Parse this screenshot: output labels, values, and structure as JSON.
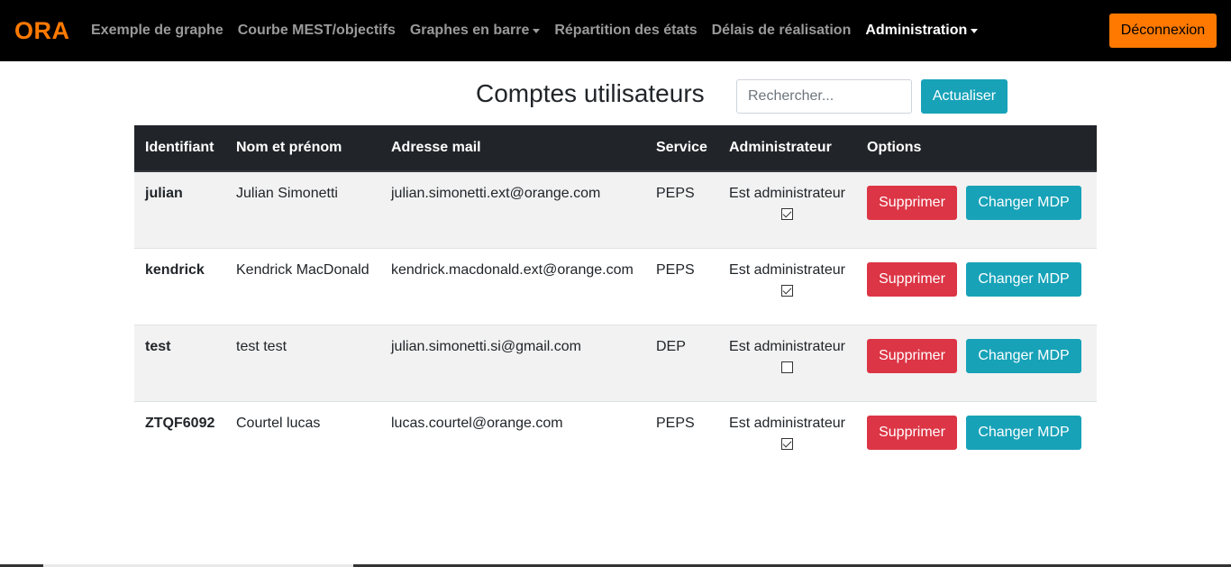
{
  "navbar": {
    "brand": "ORA",
    "links": [
      {
        "label": "Exemple de graphe",
        "dropdown": false,
        "active": false
      },
      {
        "label": "Courbe MEST/objectifs",
        "dropdown": false,
        "active": false
      },
      {
        "label": "Graphes en barre",
        "dropdown": true,
        "active": false
      },
      {
        "label": "Répartition des états",
        "dropdown": false,
        "active": false
      },
      {
        "label": "Délais de réalisation",
        "dropdown": false,
        "active": false
      },
      {
        "label": "Administration",
        "dropdown": true,
        "active": true
      }
    ],
    "logout_label": "Déconnexion"
  },
  "page": {
    "title": "Comptes utilisateurs",
    "search_placeholder": "Rechercher...",
    "refresh_label": "Actualiser"
  },
  "table": {
    "headers": [
      "Identifiant",
      "Nom et prénom",
      "Adresse mail",
      "Service",
      "Administrateur",
      "Options"
    ],
    "rows": [
      {
        "id": "julian",
        "name": "Julian Simonetti",
        "email": "julian.simonetti.ext@orange.com",
        "service": "PEPS",
        "admin_label": "Est administrateur",
        "is_admin": true,
        "delete_label": "Supprimer",
        "change_pwd_label": "Changer MDP"
      },
      {
        "id": "kendrick",
        "name": "Kendrick MacDonald",
        "email": "kendrick.macdonald.ext@orange.com",
        "service": "PEPS",
        "admin_label": "Est administrateur",
        "is_admin": true,
        "delete_label": "Supprimer",
        "change_pwd_label": "Changer MDP"
      },
      {
        "id": "test",
        "name": "test test",
        "email": "julian.simonetti.si@gmail.com",
        "service": "DEP",
        "admin_label": "Est administrateur",
        "is_admin": false,
        "delete_label": "Supprimer",
        "change_pwd_label": "Changer MDP"
      },
      {
        "id": "ZTQF6092",
        "name": "Courtel lucas",
        "email": "lucas.courtel@orange.com",
        "service": "PEPS",
        "admin_label": "Est administrateur",
        "is_admin": true,
        "delete_label": "Supprimer",
        "change_pwd_label": "Changer MDP"
      }
    ]
  },
  "colors": {
    "brand": "#ff7900",
    "navbar_bg": "#000000",
    "info": "#17a2b8",
    "danger": "#dc3545",
    "table_header_bg": "#212529"
  }
}
